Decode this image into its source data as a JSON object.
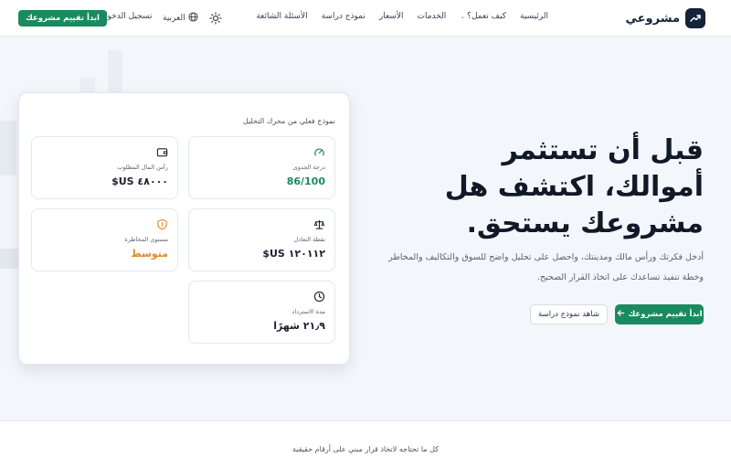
{
  "nav": {
    "brand": "مشروعي",
    "links": [
      {
        "label": "الرئيسية",
        "has_dropdown": false
      },
      {
        "label": "كيف تعمل؟",
        "has_dropdown": true
      },
      {
        "label": "الخدمات",
        "has_dropdown": false
      },
      {
        "label": "الأسعار",
        "has_dropdown": false
      },
      {
        "label": "نموذج دراسة",
        "has_dropdown": false
      },
      {
        "label": "الأسئلة الشائعة",
        "has_dropdown": false
      }
    ],
    "language": "العربية",
    "login": "تسجيل الدخول",
    "cta": "ابدأ تقييم مشروعك",
    "icons": {
      "brand": "trend-up-icon",
      "theme": "sun-icon",
      "language": "globe-icon"
    }
  },
  "hero": {
    "headline": "قبل أن تستثمر أموالك، اكتشف هل مشروعك يستحق.",
    "subtext": "أدخل فكرتك ورأس مالك ومدينتك، واحصل على تحليل واضح للسوق والتكاليف والمخاطر وخطة تنفيذ تساعدك على اتخاذ القرار الصحيح.",
    "primary_button": "ابدأ تقييم مشروعك",
    "secondary_button": "شاهد نموذج دراسة"
  },
  "sample_card": {
    "title": "نموذج فعلي من محرك التحليل",
    "metrics": {
      "feasibility": {
        "label": "درجة الجدوى",
        "value": "86/100",
        "icon": "gauge-icon",
        "color": "#1a8a5f"
      },
      "capital": {
        "label": "رأس المال المطلوب",
        "value": "٤٨٠٠٠ US$",
        "icon": "wallet-icon",
        "color": "#1b2330"
      },
      "break_even": {
        "label": "نقطة التعادل",
        "value": "١٢٠١١٢ US$",
        "icon": "scale-icon",
        "color": "#1b2330"
      },
      "risk": {
        "label": "مستوى المخاطرة",
        "value": "متوسط",
        "icon": "shield-alert-icon",
        "color": "#e08a2c"
      },
      "payback": {
        "label": "مدة الاسترداد",
        "value": "٢١٫٩ شهرًا",
        "icon": "clock-icon",
        "color": "#1b2330"
      }
    }
  },
  "bottom_section": {
    "tagline": "كل ما تحتاجه لاتخاذ قرار مبني على أرقام حقيقية"
  },
  "colors": {
    "accent_green": "#1a8a5f",
    "brand_dark": "#14223a",
    "warning_orange": "#e08a2c",
    "background": "#f4f7fb"
  }
}
